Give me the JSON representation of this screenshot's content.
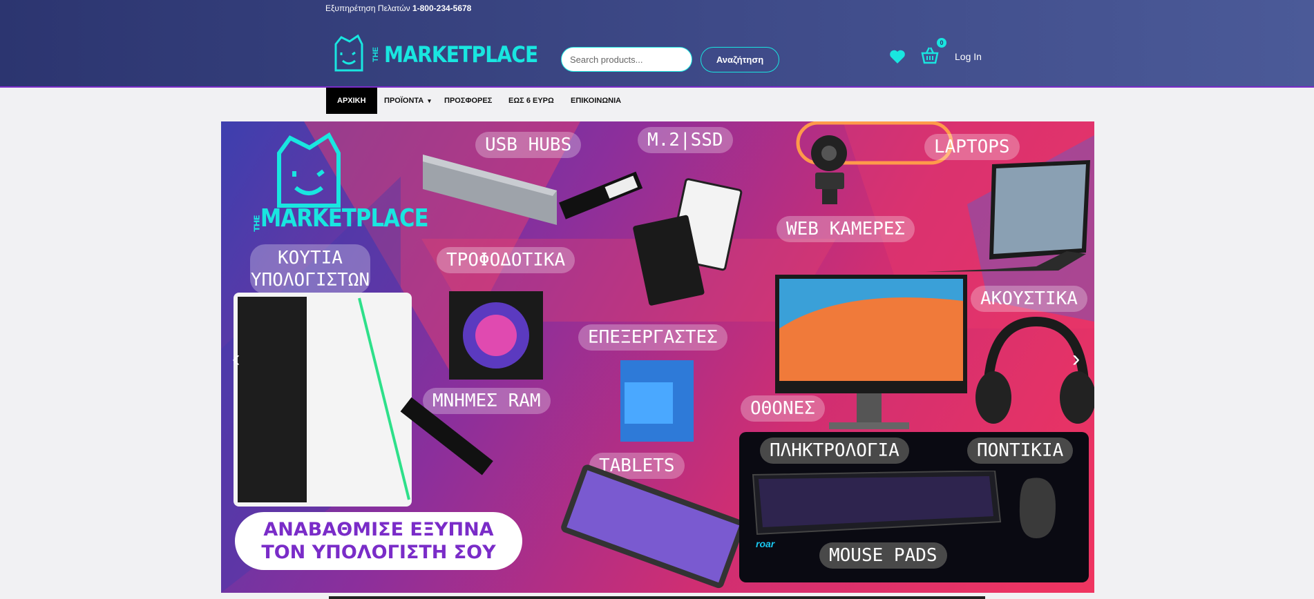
{
  "header": {
    "support_label": "Εξυπηρέτηση Πελατών",
    "support_phone": "1-800-234-5678",
    "logo_small": "THE",
    "logo_text": "MARKETPLACE",
    "search": {
      "placeholder": "Search products...",
      "button": "Αναζήτηση"
    },
    "cart_count": "0",
    "login": "Log In"
  },
  "nav": {
    "items": [
      "ΑΡΧΙΚΗ",
      "ΠΡΟΪΟΝΤΑ",
      "ΠΡΟΣΦΟΡΕΣ",
      "ΕΩΣ 6 ΕΥΡΩ",
      "ΕΠΙΚΟΙΝΩΝΙΑ"
    ],
    "active": "ΑΡΧΙΚΗ"
  },
  "banner": {
    "logo_small": "THE",
    "logo_text": "MARKETPLACE",
    "labels": {
      "usb_hubs": "USB HUBS",
      "ssd": "M.2|SSD",
      "laptops": "LAPTOPS",
      "cases_line1": "ΚΟΥΤΙΑ",
      "cases_line2": "ΥΠΟΛΟΓΙΣΤΩΝ",
      "psu": "ΤΡΟΦΟΔΟΤΙΚΑ",
      "webcams": "WEB ΚΑΜΕΡΕΣ",
      "headphones": "ΑΚΟΥΣΤΙΚΑ",
      "cpus": "ΕΠΕΞΕΡΓΑΣΤΕΣ",
      "ram": "ΜΝΗΜΕΣ RAM",
      "monitors": "ΟΘΟΝΕΣ",
      "tablets": "TABLETS",
      "keyboards": "ΠΛΗΚΤΡΟΛΟΓΙΑ",
      "mice": "ΠΟΝΤΙΚΙΑ",
      "mousepads": "MOUSE PADS"
    },
    "tagline_line1": "ΑΝΑΒΑΘΜΙΣΕ ΕΞΥΠΝΑ",
    "tagline_line2": "ΤΟΝ ΥΠΟΛΟΓΙΣΤΗ ΣΟΥ",
    "brand_mark": "roar",
    "prev_arrow": "‹",
    "next_arrow": "›"
  },
  "colors": {
    "accent": "#19e6e0",
    "header_bg": "#3a4584",
    "tagline": "#7a2cc8"
  }
}
